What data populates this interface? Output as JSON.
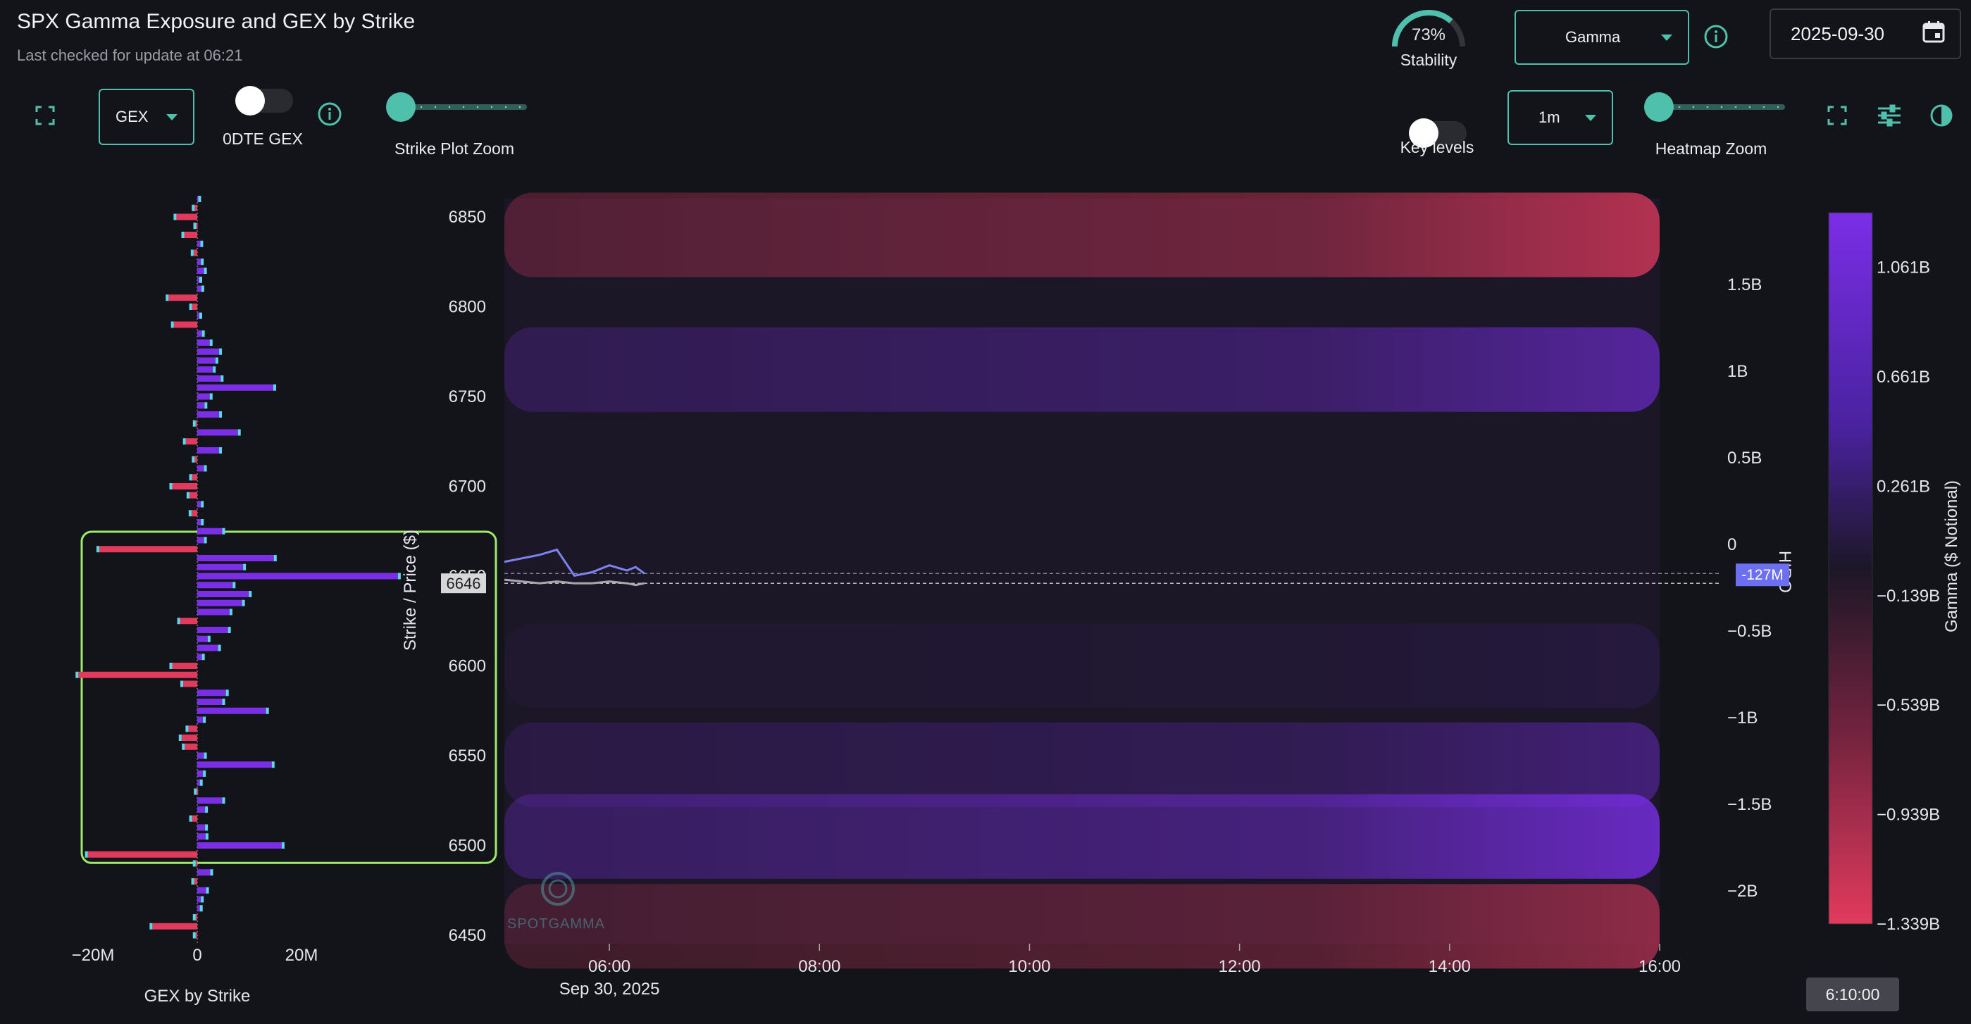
{
  "header": {
    "title": "SPX Gamma Exposure and GEX by Strike",
    "subtitle": "Last checked for update at 06:21"
  },
  "stability": {
    "value_text": "73%",
    "label": "Stability",
    "value": 0.73
  },
  "top_right": {
    "metric_select": "Gamma",
    "date": "2025-09-30"
  },
  "toolbar_left": {
    "gex_select": "GEX",
    "odte_label": "0DTE GEX",
    "strike_zoom_label": "Strike Plot Zoom"
  },
  "toolbar_right": {
    "key_levels_label": "Key levels",
    "interval_select": "1m",
    "heatmap_zoom_label": "Heatmap Zoom"
  },
  "strike_plot": {
    "x_ticks": [
      "−20M",
      "0",
      "20M"
    ],
    "xlabel": "GEX by Strike"
  },
  "heatmap": {
    "ylabel": "Strike / Price ($)",
    "y_ticks": [
      "6850",
      "6800",
      "6750",
      "6700",
      "6650",
      "6600",
      "6550",
      "6500",
      "6450"
    ],
    "x_ticks": [
      "06:00",
      "08:00",
      "10:00",
      "12:00",
      "14:00",
      "16:00"
    ],
    "x_date": "Sep 30, 2025",
    "current_price_label": "6646",
    "right_axis_ticks": [
      "1.5B",
      "1B",
      "0.5B",
      "0",
      "−0.5B",
      "−1B",
      "−1.5B",
      "−2B"
    ],
    "right_axis_title": "HIRO",
    "hiro_value_label": "-127M",
    "watermark": "SPOTGAMMA"
  },
  "colorbar": {
    "title": "Gamma ($ Notional)",
    "ticks": [
      "1.061B",
      "0.661B",
      "0.261B",
      "−0.139B",
      "−0.539B",
      "−0.939B",
      "−1.339B"
    ]
  },
  "time_tooltip": "6:10:00",
  "colors": {
    "accent": "#4fc0ac",
    "positive": "#7a2ee6",
    "negative": "#e23a5d",
    "background": "#13141a",
    "highlight_box": "#9ee86a",
    "hiro_line": "#7c83f0"
  },
  "chart_data": [
    {
      "type": "bar",
      "orientation": "horizontal",
      "xlabel": "GEX by Strike",
      "x_ticks": [
        "−20M",
        "0",
        "20M"
      ],
      "xlim": [
        -25000000,
        32000000
      ],
      "ylim": [
        6450,
        6860
      ],
      "categories": [
        6860,
        6855,
        6850,
        6845,
        6840,
        6835,
        6830,
        6825,
        6820,
        6815,
        6810,
        6805,
        6800,
        6795,
        6790,
        6785,
        6780,
        6775,
        6770,
        6765,
        6760,
        6755,
        6750,
        6745,
        6740,
        6735,
        6730,
        6725,
        6720,
        6715,
        6710,
        6705,
        6700,
        6695,
        6690,
        6685,
        6680,
        6675,
        6670,
        6665,
        6660,
        6655,
        6650,
        6645,
        6640,
        6635,
        6630,
        6625,
        6620,
        6615,
        6610,
        6605,
        6600,
        6595,
        6590,
        6585,
        6580,
        6575,
        6570,
        6565,
        6560,
        6555,
        6550,
        6545,
        6540,
        6535,
        6530,
        6525,
        6520,
        6515,
        6510,
        6505,
        6500,
        6495,
        6490,
        6485,
        6480,
        6475,
        6470,
        6465,
        6460,
        6455,
        6450
      ],
      "values": [
        200000,
        -500000,
        -4000000,
        -200000,
        -2500000,
        600000,
        -700000,
        700000,
        1300000,
        400000,
        800000,
        -5500000,
        -1000000,
        400000,
        -4500000,
        900000,
        2400000,
        4200000,
        3500000,
        3000000,
        4500000,
        14600000,
        2400000,
        1400000,
        4200000,
        -300000,
        7800000,
        -2200000,
        4200000,
        -500000,
        1300000,
        -1000000,
        -4800000,
        -1500000,
        700000,
        -1100000,
        700000,
        4800000,
        1300000,
        -18800000,
        14700000,
        8800000,
        38500000,
        6800000,
        9900000,
        8600000,
        6200000,
        -3300000,
        5900000,
        2000000,
        4000000,
        900000,
        -4800000,
        -22800000,
        -2700000,
        5500000,
        4800000,
        13200000,
        1100000,
        -1700000,
        -3000000,
        -2400000,
        1300000,
        14300000,
        1100000,
        500000,
        -100000,
        4800000,
        1500000,
        -1000000,
        1500000,
        1600000,
        16200000,
        -21000000,
        -300000,
        2500000,
        -600000,
        1700000,
        700000,
        500000,
        -300000,
        -8600000,
        -300000
      ],
      "highlight_range": [
        6495,
        6670
      ]
    },
    {
      "type": "heatmap",
      "title": "",
      "xlabel": "",
      "ylabel": "Strike / Price ($)",
      "x_ticks": [
        "06:00",
        "08:00",
        "10:00",
        "12:00",
        "14:00",
        "16:00"
      ],
      "x_range": [
        "05:00",
        "16:00"
      ],
      "ylim": [
        6450,
        6860
      ],
      "color_scale": {
        "label": "Gamma ($ Notional)",
        "min": -1.339,
        "max": 1.261,
        "unit": "B"
      },
      "bands": [
        {
          "strike": 6840,
          "gamma_at_close": -1.2
        },
        {
          "strike": 6765,
          "gamma_at_close": 0.9
        },
        {
          "strike": 6600,
          "gamma_at_close": 0.15
        },
        {
          "strike": 6545,
          "gamma_at_close": 0.6
        },
        {
          "strike": 6505,
          "gamma_at_close": 1.2
        },
        {
          "strike": 6455,
          "gamma_at_close": -0.9
        }
      ],
      "price_line": {
        "name": "",
        "x": [
          "05:00",
          "05:10",
          "05:20",
          "05:30",
          "05:40",
          "05:50",
          "06:00",
          "06:10",
          "06:15",
          "06:20"
        ],
        "y": [
          6648,
          6647,
          6646,
          6647,
          6646,
          6646,
          6647,
          6646,
          6645,
          6646
        ]
      },
      "hiro_line": {
        "name": "HIRO",
        "x": [
          "05:00",
          "05:10",
          "05:20",
          "05:30",
          "05:40",
          "05:50",
          "06:00",
          "06:10",
          "06:15",
          "06:20"
        ],
        "y": [
          -60,
          -40,
          -20,
          10,
          -140,
          -120,
          -80,
          -110,
          -90,
          -127
        ],
        "unit": "M",
        "right_axis_range": [
          -2200,
          2000
        ],
        "current_label": "-127M"
      },
      "current_price": 6646
    }
  ]
}
